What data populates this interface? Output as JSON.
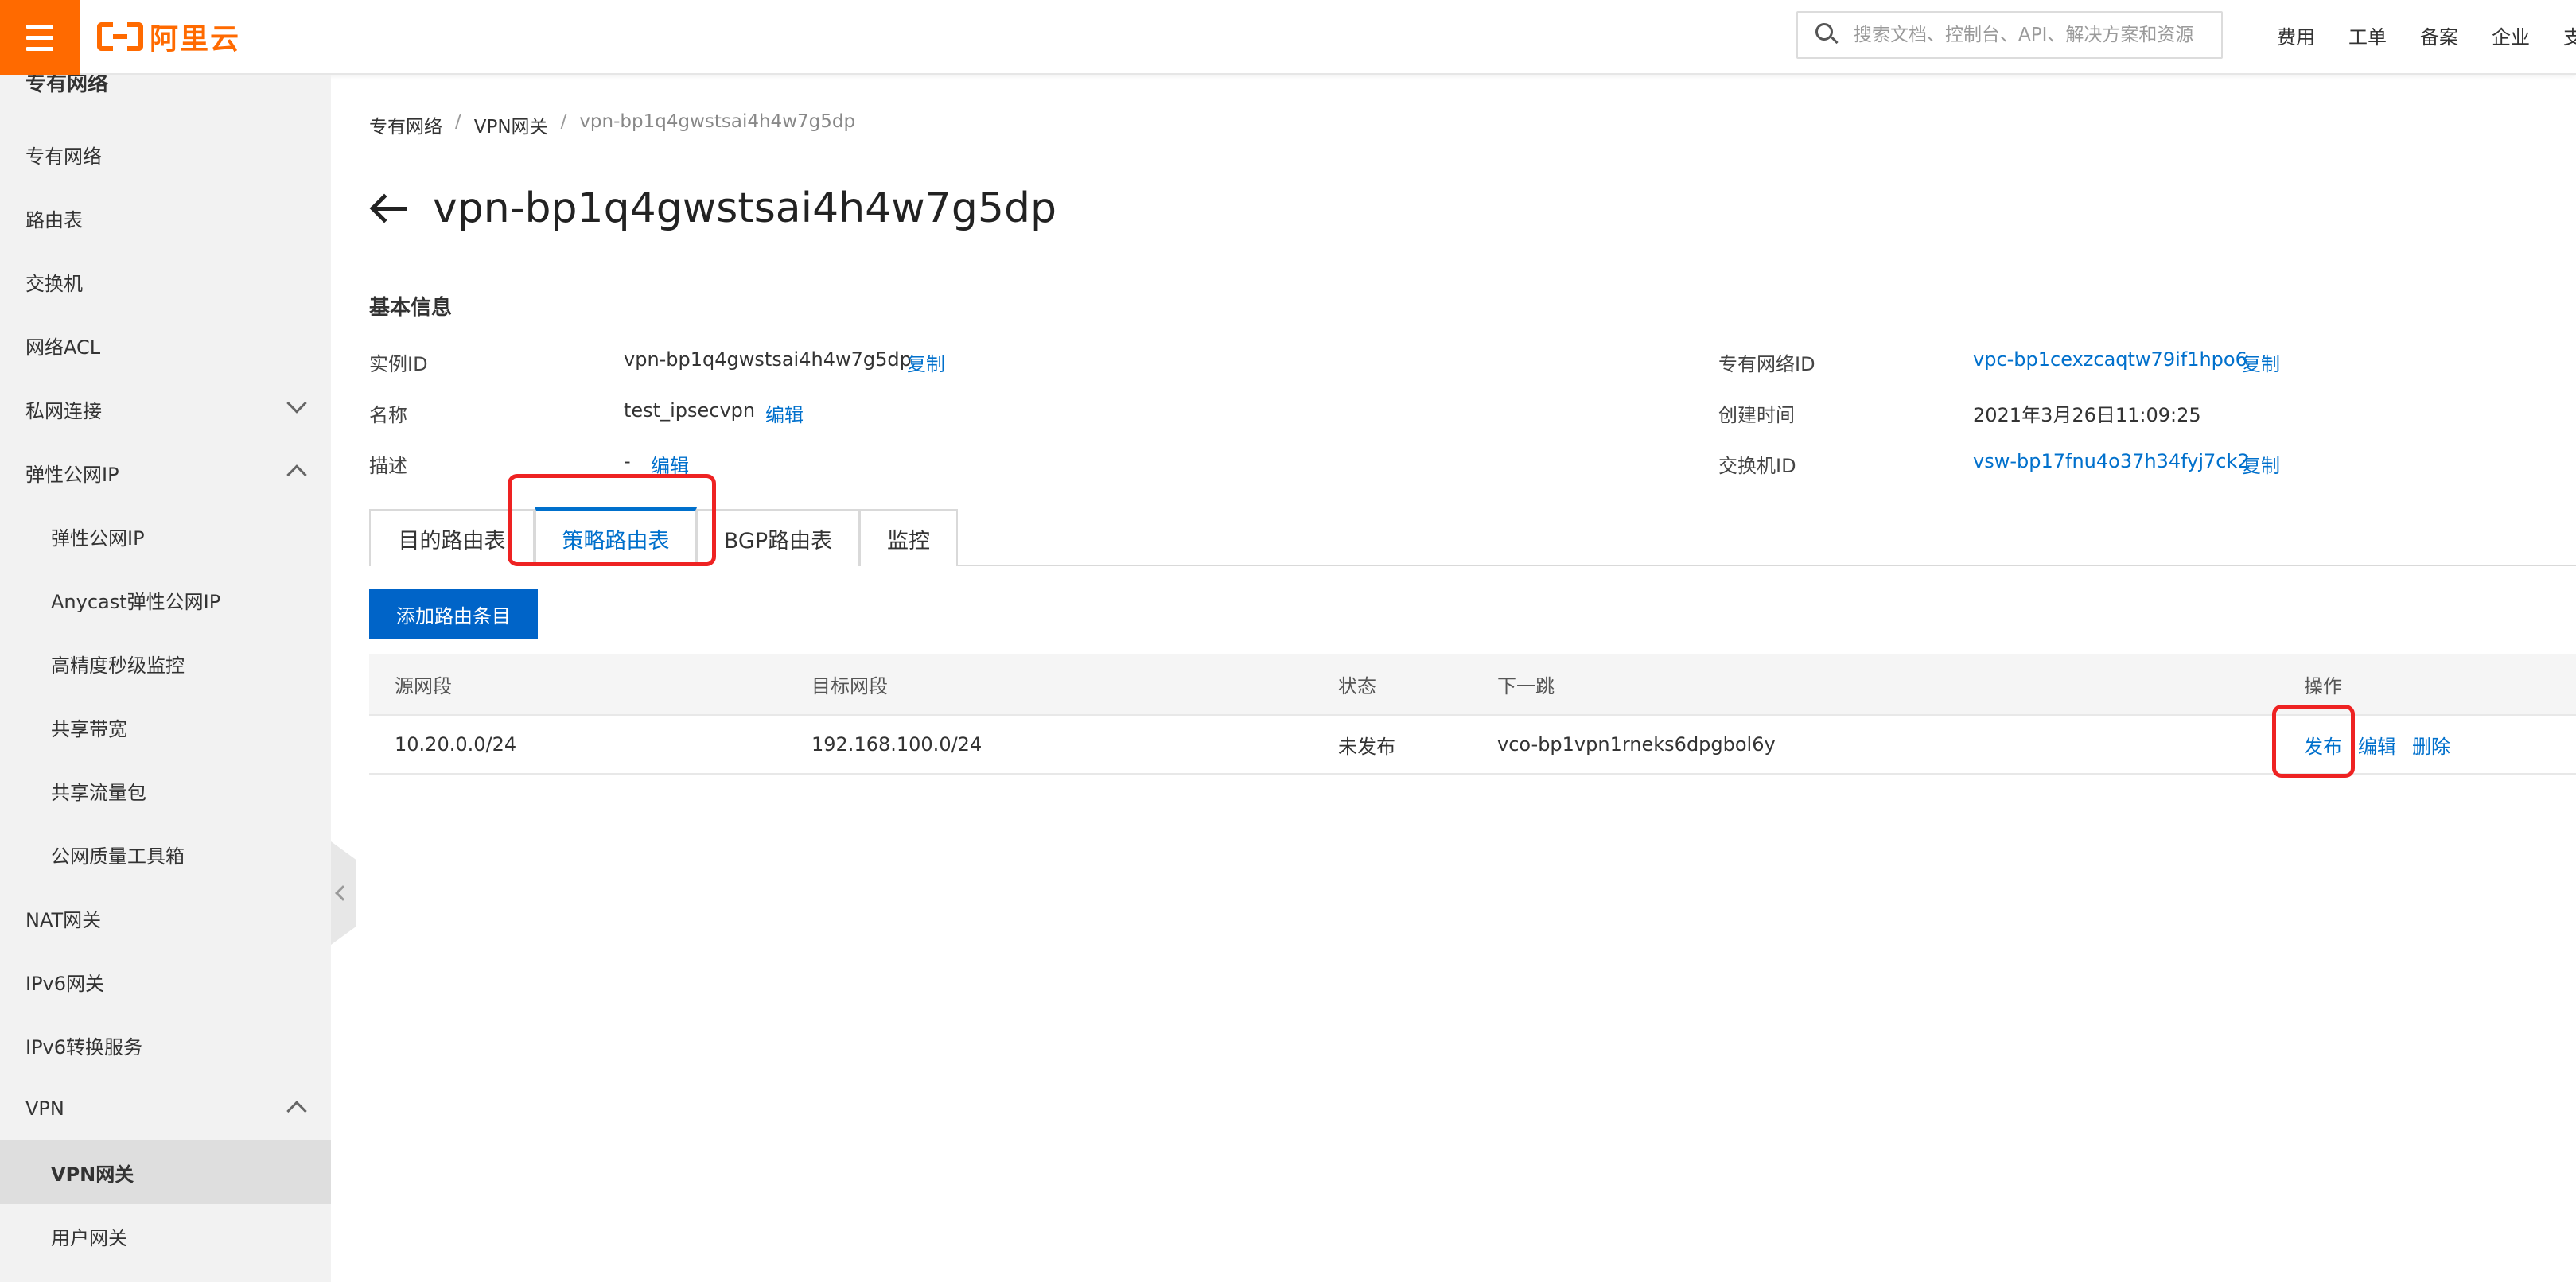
{
  "header": {
    "logo_text": "阿里云",
    "search_placeholder": "搜索文档、控制台、API、解决方案和资源",
    "nav": [
      "费用",
      "工单",
      "备案",
      "企业",
      "支"
    ]
  },
  "sidebar": {
    "title": "专有网络",
    "items": [
      {
        "label": "专有网络"
      },
      {
        "label": "路由表"
      },
      {
        "label": "交换机"
      },
      {
        "label": "网络ACL"
      },
      {
        "label": "私网连接"
      },
      {
        "label": "弹性公网IP"
      },
      {
        "label": "弹性公网IP"
      },
      {
        "label": "Anycast弹性公网IP"
      },
      {
        "label": "高精度秒级监控"
      },
      {
        "label": "共享带宽"
      },
      {
        "label": "共享流量包"
      },
      {
        "label": "公网质量工具箱"
      },
      {
        "label": "NAT网关"
      },
      {
        "label": "IPv6网关"
      },
      {
        "label": "IPv6转换服务"
      },
      {
        "label": "VPN"
      },
      {
        "label": "VPN网关"
      },
      {
        "label": "用户网关"
      }
    ]
  },
  "breadcrumb": {
    "items": [
      "专有网络",
      "VPN网关",
      "vpn-bp1q4gwstsai4h4w7g5dp"
    ],
    "separator": "/"
  },
  "page": {
    "title": "vpn-bp1q4gwstsai4h4w7g5dp"
  },
  "basic_info": {
    "section_title": "基本信息",
    "instance_id": {
      "label": "实例ID",
      "value": "vpn-bp1q4gwstsai4h4w7g5dp",
      "action": "复制"
    },
    "name": {
      "label": "名称",
      "value": "test_ipsecvpn",
      "action": "编辑"
    },
    "description": {
      "label": "描述",
      "value": "-",
      "action": "编辑"
    },
    "vpc_id": {
      "label": "专有网络ID",
      "value": "vpc-bp1cexzcaqtw79if1hpo6",
      "action": "复制"
    },
    "created_time": {
      "label": "创建时间",
      "value": "2021年3月26日11:09:25"
    },
    "vswitch_id": {
      "label": "交换机ID",
      "value": "vsw-bp17fnu4o37h34fyj7ck2",
      "action": "复制"
    }
  },
  "tabs": [
    {
      "label": "目的路由表"
    },
    {
      "label": "策略路由表"
    },
    {
      "label": "BGP路由表"
    },
    {
      "label": "监控"
    }
  ],
  "active_tab": "策略路由表",
  "add_button": "添加路由条目",
  "table": {
    "headers": [
      "源网段",
      "目标网段",
      "状态",
      "下一跳",
      "操作"
    ],
    "rows": [
      {
        "source": "10.20.0.0/24",
        "dest": "192.168.100.0/24",
        "status": "未发布",
        "next_hop": "vco-bp1vpn1rneks6dpgbol6y",
        "actions": [
          "发布",
          "编辑",
          "删除"
        ]
      }
    ]
  },
  "colors": {
    "brand": "#ff6a00",
    "link": "#0070cc",
    "primary_button": "#0064c8",
    "highlight": "#ee2222"
  }
}
